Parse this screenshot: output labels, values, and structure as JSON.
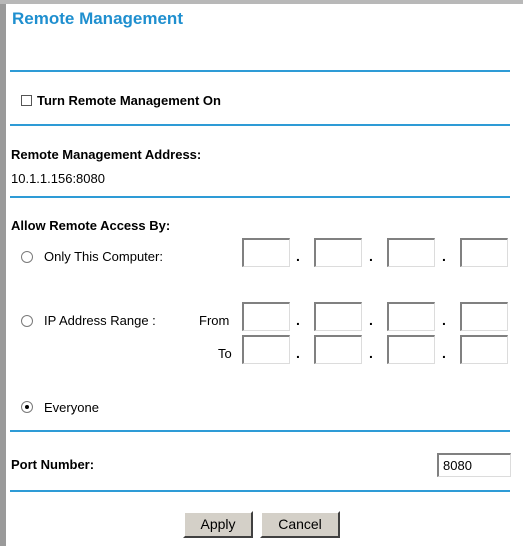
{
  "page": {
    "title": "Remote Management"
  },
  "remote_on": {
    "label": "Turn Remote Management On",
    "checked": false
  },
  "address": {
    "label": "Remote Management Address:",
    "value": "10.1.1.156:8080"
  },
  "access": {
    "heading": "Allow Remote Access By:",
    "only_this_computer": "Only This Computer:",
    "ip_range": "IP Address Range :",
    "from_label": "From",
    "to_label": "To",
    "everyone": "Everyone",
    "selected": "Everyone"
  },
  "port": {
    "label": "Port Number:",
    "value": "8080"
  },
  "buttons": {
    "apply": "Apply",
    "cancel": "Cancel"
  },
  "colors": {
    "title": "#1f8fcf",
    "divider": "#2e9bd6"
  }
}
